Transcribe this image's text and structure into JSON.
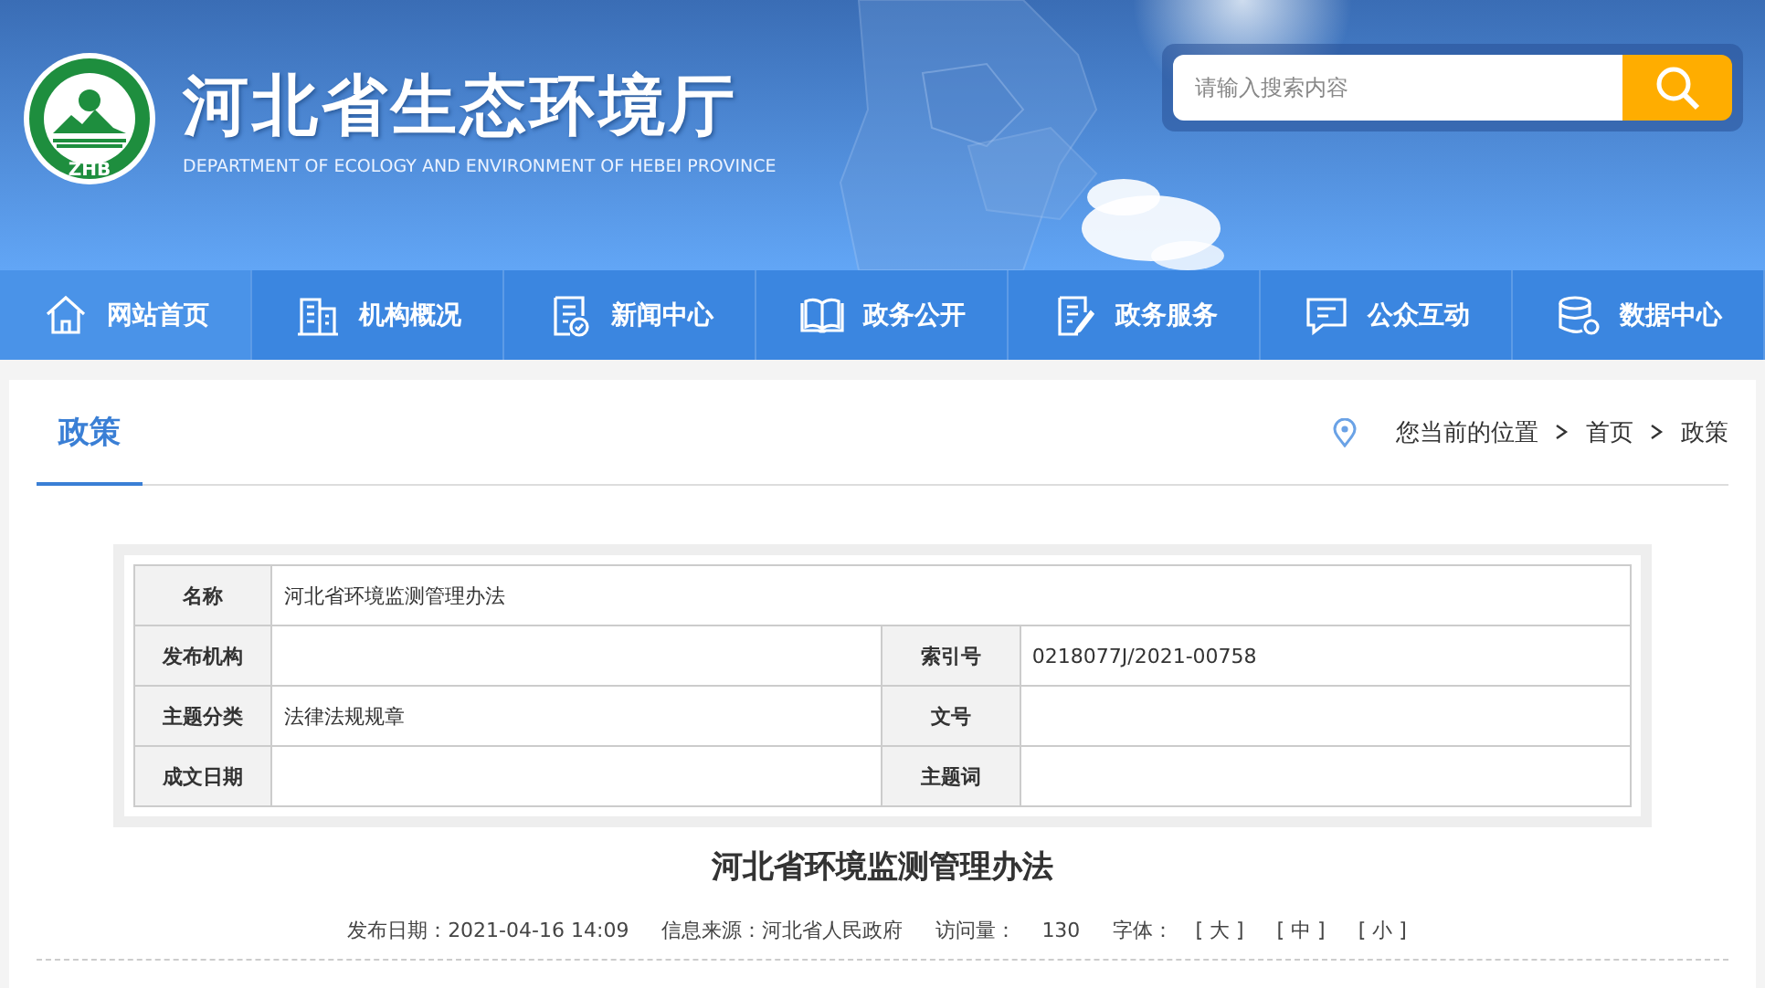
{
  "header": {
    "logo_letters": "ZHB",
    "title": "河北省生态环境厅",
    "subtitle": "DEPARTMENT OF ECOLOGY AND ENVIRONMENT OF HEBEI PROVINCE",
    "search": {
      "placeholder": "请输入搜索内容"
    }
  },
  "nav": [
    {
      "label": "网站首页",
      "selected": true
    },
    {
      "label": "机构概况",
      "selected": false
    },
    {
      "label": "新闻中心",
      "selected": false
    },
    {
      "label": "政务公开",
      "selected": false
    },
    {
      "label": "政务服务",
      "selected": false
    },
    {
      "label": "公众互动",
      "selected": false
    },
    {
      "label": "数据中心",
      "selected": false
    }
  ],
  "section_tab": "政策",
  "breadcrumb": {
    "label": "您当前的位置",
    "items": [
      "首页",
      "政策"
    ]
  },
  "info_table": {
    "rows": [
      [
        {
          "label": "名称",
          "value": "河北省环境监测管理办法"
        }
      ],
      [
        {
          "label": "发布机构"
        },
        {
          "label": "索引号",
          "value": "0218077J/2021-00758"
        }
      ],
      [
        {
          "label": "主题分类",
          "value": "法律法规规章"
        },
        {
          "label": "文号"
        }
      ],
      [
        {
          "label": "成文日期"
        },
        {
          "label": "主题词"
        }
      ]
    ]
  },
  "article": {
    "title": "河北省环境监测管理办法",
    "date": "发布日期：2021-04-16 14:09",
    "source": "信息来源：河北省人民政府",
    "views_label": "访问量：",
    "views": "130",
    "font_label": "字体：",
    "font_sizes": [
      "[ 大 ]",
      "[ 中 ]",
      "[ 小 ]"
    ]
  }
}
